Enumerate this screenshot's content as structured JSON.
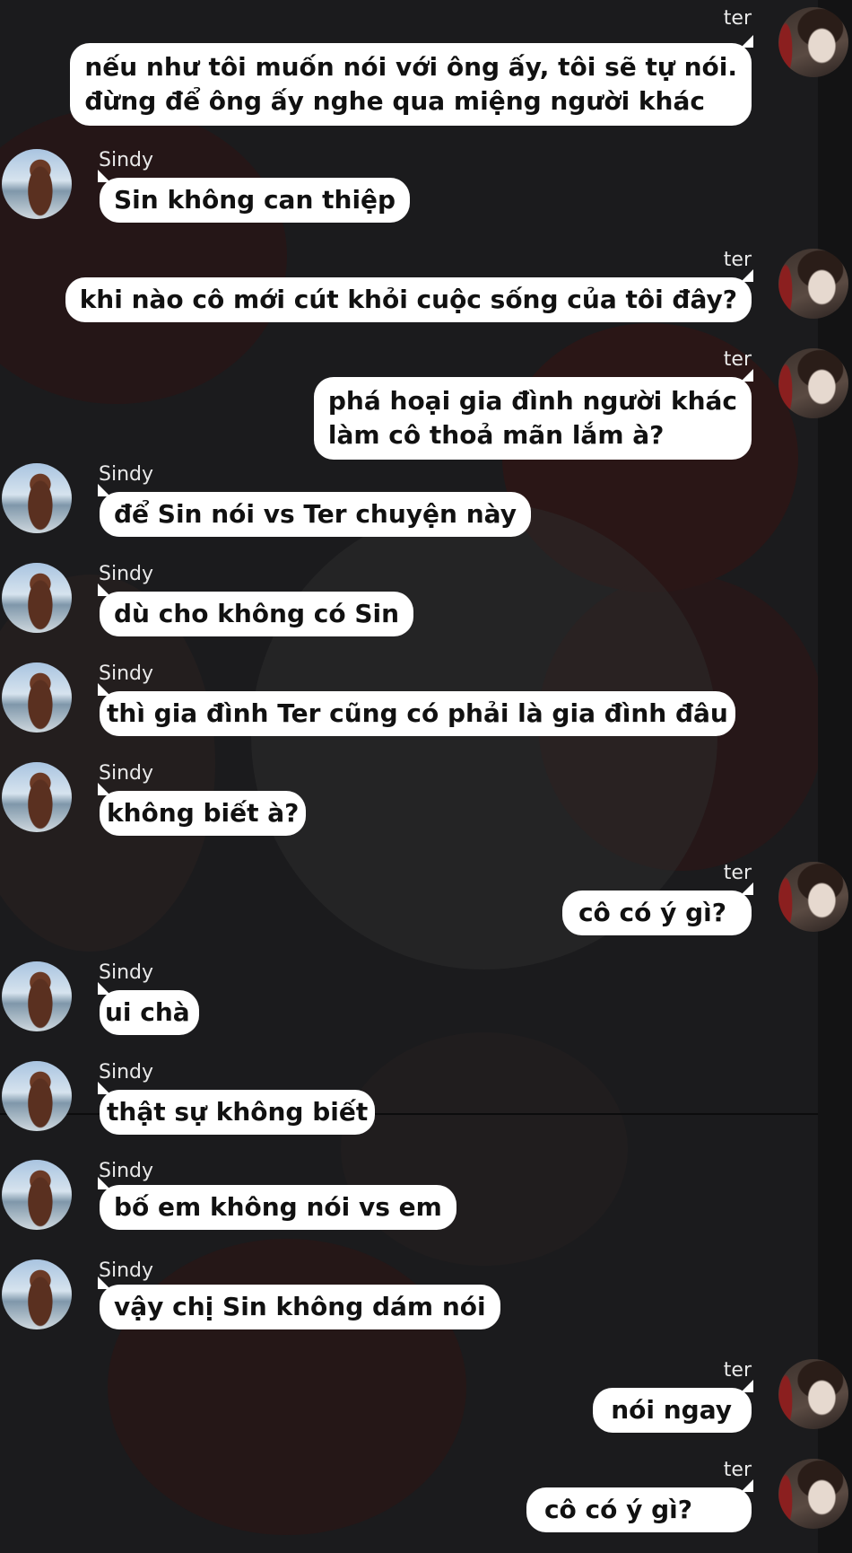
{
  "contacts": {
    "me": "ter",
    "other": "Sindy"
  },
  "colors": {
    "bubble": "#ffffff",
    "text": "#111111",
    "name": "#e9e9e9",
    "background": "#1b1b1d"
  },
  "messages": [
    {
      "sender": "ter",
      "side": "out",
      "lines": [
        "nếu như tôi muốn nói với ông ấy, tôi sẽ tự nói.",
        "đừng để ông ấy nghe qua miệng người khác"
      ]
    },
    {
      "sender": "Sindy",
      "side": "in",
      "lines": [
        "Sin không can thiệp"
      ]
    },
    {
      "sender": "ter",
      "side": "out",
      "lines": [
        "khi nào cô mới cút khỏi cuộc sống của tôi đây?"
      ]
    },
    {
      "sender": "ter",
      "side": "out",
      "lines": [
        "phá hoại gia đình người khác",
        "làm cô thoả mãn lắm à?"
      ]
    },
    {
      "sender": "Sindy",
      "side": "in",
      "lines": [
        "để Sin nói vs Ter chuyện này"
      ]
    },
    {
      "sender": "Sindy",
      "side": "in",
      "lines": [
        "dù cho không có Sin"
      ]
    },
    {
      "sender": "Sindy",
      "side": "in",
      "lines": [
        "thì gia đình Ter cũng có phải là gia đình đâu"
      ]
    },
    {
      "sender": "Sindy",
      "side": "in",
      "lines": [
        "không biết à?"
      ]
    },
    {
      "sender": "ter",
      "side": "out",
      "lines": [
        "cô có ý gì?"
      ]
    },
    {
      "sender": "Sindy",
      "side": "in",
      "lines": [
        "ui chà"
      ]
    },
    {
      "sender": "Sindy",
      "side": "in",
      "lines": [
        "thật sự không biết"
      ]
    },
    {
      "sender": "Sindy",
      "side": "in",
      "lines": [
        "bố em không nói vs em"
      ]
    },
    {
      "sender": "Sindy",
      "side": "in",
      "lines": [
        "vậy chị Sin không dám nói"
      ]
    },
    {
      "sender": "ter",
      "side": "out",
      "lines": [
        "nói ngay"
      ]
    },
    {
      "sender": "ter",
      "side": "out",
      "lines": [
        "cô có ý gì?"
      ]
    }
  ]
}
